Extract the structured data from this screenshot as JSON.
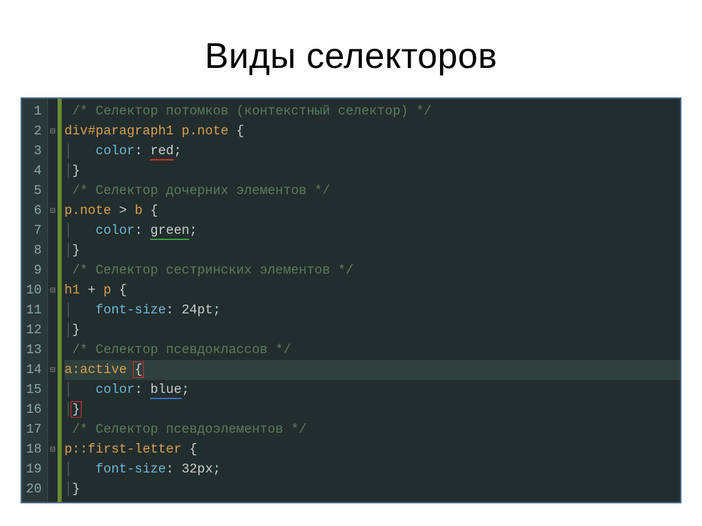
{
  "title": "Виды селекторов",
  "line_numbers": [
    "1",
    "2",
    "3",
    "4",
    "5",
    "6",
    "7",
    "8",
    "9",
    "10",
    "11",
    "12",
    "13",
    "14",
    "15",
    "16",
    "17",
    "18",
    "19",
    "20"
  ],
  "fold_markers": [
    "",
    "⊟",
    "",
    "",
    "",
    "⊟",
    "",
    "",
    "",
    "⊟",
    "",
    "",
    "",
    "⊟",
    "",
    "",
    "",
    "⊟",
    "",
    ""
  ],
  "current_line_index": 13,
  "code": {
    "l1": {
      "comment": "/* Селектор потомков (контекстный селектор) */"
    },
    "l2": {
      "sel1": "div",
      "sel2": "#paragraph1",
      "sp": " ",
      "sel3": "p",
      "sel4": ".note",
      "brace": " {"
    },
    "l3": {
      "prop": "color",
      "colon": ": ",
      "val": "red",
      "semi": ";"
    },
    "l4": {
      "brace": "}"
    },
    "l5": {
      "comment": "/* Селектор дочерних элементов */"
    },
    "l6": {
      "sel1": "p",
      "sel2": ".note",
      "combinator": " > ",
      "sel3": "b",
      "brace": " {"
    },
    "l7": {
      "prop": "color",
      "colon": ": ",
      "val": "green",
      "semi": ";"
    },
    "l8": {
      "brace": "}"
    },
    "l9": {
      "comment": "/* Селектор сестринских элементов */"
    },
    "l10": {
      "sel1": "h1",
      "combinator": " + ",
      "sel2": "p",
      "brace": " {"
    },
    "l11": {
      "prop": "font-size",
      "colon": ": ",
      "val": "24pt",
      "semi": ";"
    },
    "l12": {
      "brace": "}"
    },
    "l13": {
      "comment": "/* Селектор псевдоклассов */"
    },
    "l14": {
      "sel1": "a",
      "pseudo": ":active",
      "brace": " {"
    },
    "l15": {
      "prop": "color",
      "colon": ": ",
      "val": "blue",
      "semi": ";"
    },
    "l16": {
      "brace": "}"
    },
    "l17": {
      "comment": "/* Селектор псевдоэлементов */"
    },
    "l18": {
      "sel1": "p",
      "pseudo": "::first-letter",
      "brace": " {"
    },
    "l19": {
      "prop": "font-size",
      "colon": ": ",
      "val": "32px",
      "semi": ";"
    },
    "l20": {
      "brace": "}"
    }
  }
}
